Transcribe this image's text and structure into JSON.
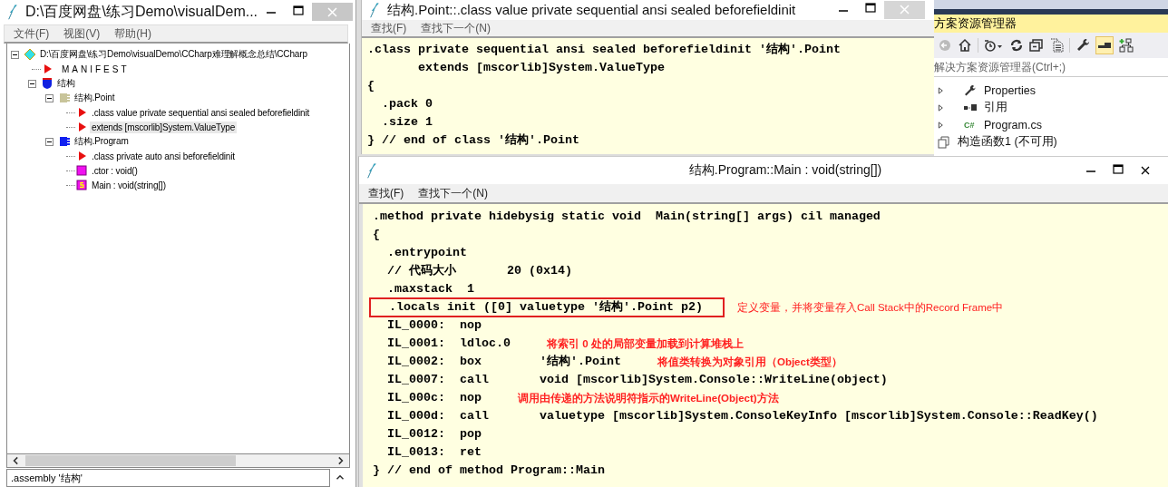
{
  "tree_window": {
    "title": "D:\\百度网盘\\练习Demo\\visualDem...",
    "menu": [
      "文件(F)",
      "视图(V)",
      "帮助(H)"
    ],
    "tree": [
      {
        "label": "D:\\百度网盘\\练习Demo\\visualDemo\\CCharp难理解概念总结\\CCharp",
        "kind": "assembly",
        "expanded": true,
        "selected": false,
        "children": [
          {
            "label": "MANIFEST",
            "kind": "manifest",
            "selected": false
          },
          {
            "label": "结构",
            "kind": "namespace",
            "expanded": true,
            "selected": false,
            "children": [
              {
                "label": "结构.Point",
                "kind": "valuetype",
                "expanded": true,
                "selected": false,
                "children": [
                  {
                    "label": ".class value private sequential ansi sealed beforefieldinit",
                    "kind": "info",
                    "selected": false
                  },
                  {
                    "label": "extends [mscorlib]System.ValueType",
                    "kind": "info",
                    "selected": true
                  }
                ]
              },
              {
                "label": "结构.Program",
                "kind": "class",
                "expanded": true,
                "selected": false,
                "children": [
                  {
                    "label": ".class private auto ansi beforefieldinit",
                    "kind": "info",
                    "selected": false
                  },
                  {
                    "label": ".ctor : void()",
                    "kind": "method",
                    "selected": false
                  },
                  {
                    "label": "Main : void(string[])",
                    "kind": "static-method",
                    "selected": false
                  }
                ]
              }
            ]
          }
        ]
      }
    ],
    "bottom_text": ".assembly '结构'"
  },
  "point_window": {
    "title": "结构.Point::.class value private sequential ansi sealed beforefieldinit",
    "menu": [
      "查找(F)",
      "查找下一个(N)"
    ],
    "code": [
      ".class private sequential ansi sealed beforefieldinit '结构'.Point",
      "       extends [mscorlib]System.ValueType",
      "{",
      "  .pack 0",
      "  .size 1",
      "} // end of class '结构'.Point"
    ]
  },
  "solution_explorer": {
    "title": "方案资源管理器",
    "search": {
      "placeholder": "解决方案资源管理器(Ctrl+;)"
    },
    "items": [
      {
        "label": "Properties",
        "kind": "properties"
      },
      {
        "label": "引用",
        "kind": "references"
      },
      {
        "label": "Program.cs",
        "kind": "csharp",
        "badge": "C#"
      },
      {
        "label": "构造函数1 (不可用)",
        "kind": "unavailable"
      }
    ]
  },
  "main_window": {
    "title": "结构.Program::Main : void(string[])",
    "menu": [
      "查找(F)",
      "查找下一个(N)"
    ],
    "code": [
      {
        "text": ".method private hidebysig static void  Main(string[] args) cil managed",
        "boxed": false
      },
      {
        "text": "{",
        "boxed": false
      },
      {
        "text": "  .entrypoint",
        "boxed": false
      },
      {
        "text": "  // 代码大小       20 (0x14)",
        "boxed": false
      },
      {
        "text": "  .maxstack  1",
        "boxed": false
      },
      {
        "text": "  .locals init ([0] valuetype '结构'.Point p2)",
        "boxed": true,
        "note": "定义变量，并将变量存入Call Stack中的Record Frame中"
      },
      {
        "text": "  IL_0000:  nop",
        "boxed": false
      },
      {
        "text": "  IL_0001:  ldloc.0",
        "boxed": false,
        "note": "将索引 0 处的局部变量加载到计算堆栈上"
      },
      {
        "text": "  IL_0002:  box        '结构'.Point",
        "boxed": false,
        "note": "将值类转换为对象引用（Object类型）"
      },
      {
        "text": "  IL_0007:  call       void [mscorlib]System.Console::WriteLine(object)",
        "boxed": false
      },
      {
        "text": "  IL_000c:  nop",
        "boxed": false,
        "note": "调用由传递的方法说明符指示的WriteLine(Object)方法"
      },
      {
        "text": "  IL_000d:  call       valuetype [mscorlib]System.ConsoleKeyInfo [mscorlib]System.Console::ReadKey()",
        "boxed": false
      },
      {
        "text": "  IL_0012:  pop",
        "boxed": false
      },
      {
        "text": "  IL_0013:  ret",
        "boxed": false
      },
      {
        "text": "} // end of method Program::Main",
        "boxed": false
      }
    ]
  }
}
